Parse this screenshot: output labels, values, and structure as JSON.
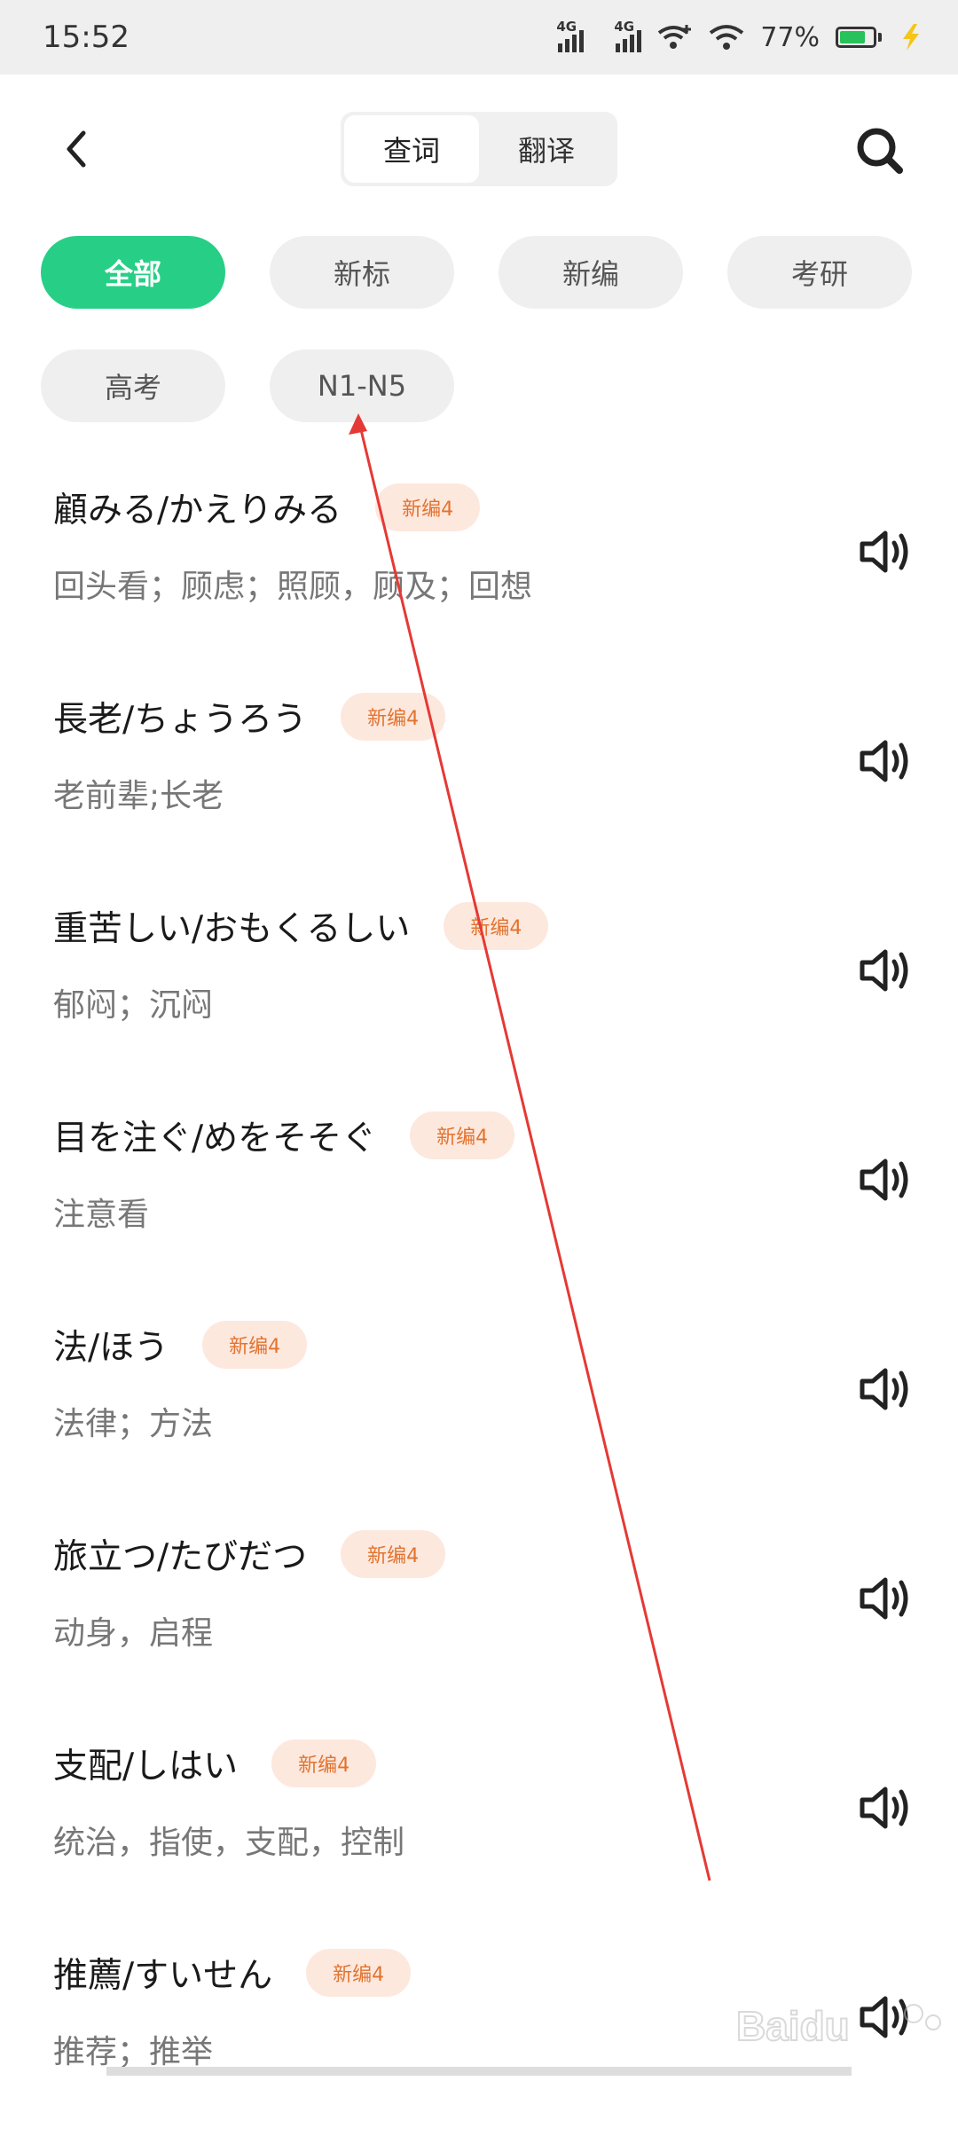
{
  "status_bar": {
    "time": "15:52",
    "signal1_label": "4G",
    "signal2_label": "4G",
    "battery_text": "77%",
    "battery_level": 0.77,
    "icons": [
      "signal-icon",
      "signal-icon",
      "wifi-plus-icon",
      "wifi-icon",
      "battery-icon",
      "charging-icon"
    ]
  },
  "header": {
    "tabs": [
      {
        "label": "查词",
        "active": true
      },
      {
        "label": "翻译",
        "active": false
      }
    ],
    "back_icon": "chevron-left-icon",
    "search_icon": "search-icon"
  },
  "filters": [
    {
      "label": "全部",
      "active": true
    },
    {
      "label": "新标",
      "active": false
    },
    {
      "label": "新编",
      "active": false
    },
    {
      "label": "考研",
      "active": false
    },
    {
      "label": "高考",
      "active": false
    },
    {
      "label": "N1-N5",
      "active": false
    }
  ],
  "words": [
    {
      "word": "顧みる/かえりみる",
      "badge": "新编4",
      "meaning": "回头看；顾虑；照顾，顾及；回想"
    },
    {
      "word": "長老/ちょうろう",
      "badge": "新编4",
      "meaning": " 老前辈;长老"
    },
    {
      "word": "重苦しい/おもくるしい",
      "badge": "新编4",
      "meaning": "郁闷；沉闷"
    },
    {
      "word": "目を注ぐ/めをそそぐ",
      "badge": "新编4",
      "meaning": "注意看"
    },
    {
      "word": "法/ほう",
      "badge": "新编4",
      "meaning": "法律；方法"
    },
    {
      "word": "旅立つ/たびだつ",
      "badge": "新编4",
      "meaning": "动身，启程"
    },
    {
      "word": "支配/しはい",
      "badge": "新编4",
      "meaning": "统治，指使，支配，控制"
    },
    {
      "word": "推薦/すいせん",
      "badge": "新编4",
      "meaning": "推荐；推举"
    }
  ],
  "colors": {
    "accent": "#27cf86",
    "badge_bg": "#fde8de",
    "badge_text": "#e2732f",
    "annotation": "#e53935"
  },
  "watermark": "Baidu"
}
